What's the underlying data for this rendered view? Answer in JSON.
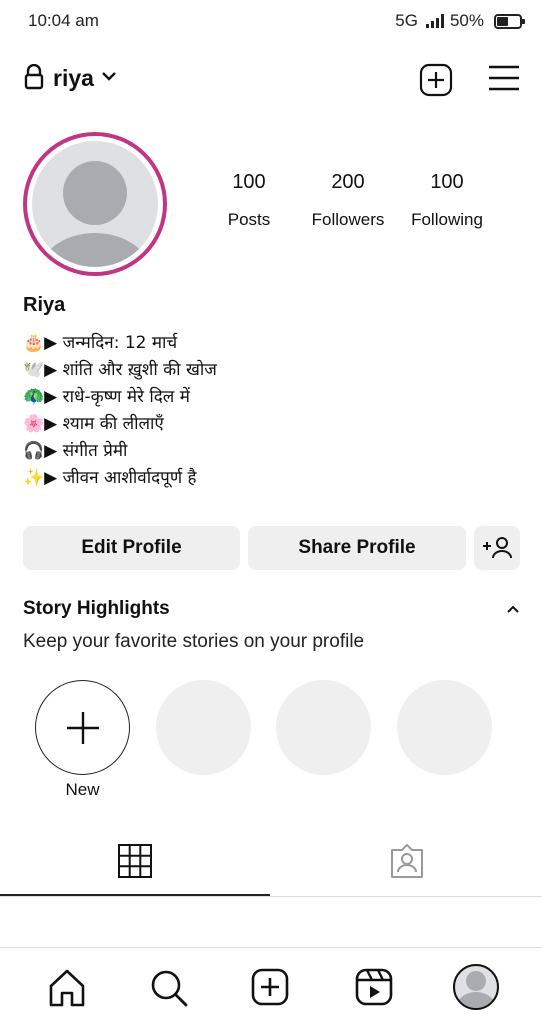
{
  "status_bar": {
    "time": "10:04 am",
    "network": "5G",
    "battery": "50%",
    "battery_level": 0.5
  },
  "header": {
    "username": "riya"
  },
  "profile": {
    "stats": [
      {
        "value": "100",
        "label": "Posts"
      },
      {
        "value": "200",
        "label": "Followers"
      },
      {
        "value": "100",
        "label": "Following"
      }
    ],
    "display_name": "Riya",
    "bio": [
      "🎂▶ जन्मदिन: 12 मार्च",
      "🕊️▶ शांति और ख़ुशी की खोज",
      "🦚▶ राधे-कृष्ण मेरे दिल में",
      "🌸▶ श्याम की लीलाएँ",
      "🎧▶ संगीत प्रेमी",
      "✨▶ जीवन आशीर्वादपूर्ण है"
    ]
  },
  "actions": {
    "edit_label": "Edit Profile",
    "share_label": "Share Profile"
  },
  "highlights": {
    "title": "Story Highlights",
    "subtitle": "Keep your favorite stories on your profile",
    "new_label": "New"
  },
  "icons": {
    "lock": "lock-icon",
    "chevron": "chevron-down-icon",
    "new_post": "plus-square-icon",
    "menu": "hamburger-menu-icon",
    "add_friend": "add-person-icon",
    "grid": "grid-icon",
    "tagged": "tagged-person-icon",
    "home": "home-icon",
    "search": "search-icon",
    "create": "create-icon",
    "reels": "reels-icon"
  },
  "colors": {
    "avatar_ring": "#c13584",
    "button_bg": "#efefef",
    "placeholder": "#efefef"
  }
}
